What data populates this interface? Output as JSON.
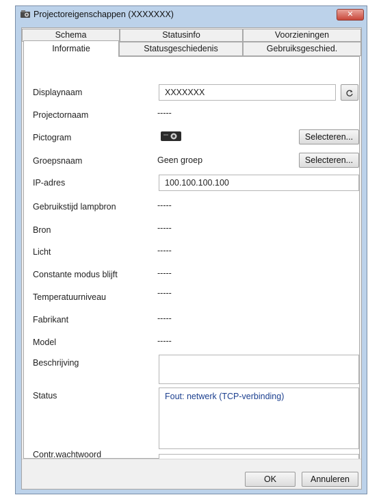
{
  "window": {
    "title": "Projectoreigenschappen (XXXXXXX)",
    "close_glyph": "✕"
  },
  "tabs": {
    "row1": [
      "Schema",
      "Statusinfo",
      "Voorzieningen"
    ],
    "row2": [
      "Informatie",
      "Statusgeschiedenis",
      "Gebruiksgeschied."
    ],
    "active": "Informatie"
  },
  "info": {
    "display_name_label": "Displaynaam",
    "display_name_value": "XXXXXXX",
    "projector_name_label": "Projectornaam",
    "projector_name_value": "-----",
    "icon_label": "Pictogram",
    "icon_select": "Selecteren...",
    "group_label": "Groepsnaam",
    "group_value": "Geen groep",
    "group_select": "Selecteren...",
    "ip_label": "IP-adres",
    "ip_value": "100.100.100.100",
    "lamp_label": "Gebruikstijd lampbron",
    "lamp_value": "-----",
    "source_label": "Bron",
    "source_value": "-----",
    "light_label": "Licht",
    "light_value": "-----",
    "constant_label": "Constante modus blijft",
    "constant_value": "-----",
    "temp_label": "Temperatuurniveau",
    "temp_value": "-----",
    "maker_label": "Fabrikant",
    "maker_value": "-----",
    "model_label": "Model",
    "model_value": "-----",
    "description_label": "Beschrijving",
    "description_value": "",
    "status_label": "Status",
    "status_value": "Fout: netwerk (TCP-verbinding)",
    "password_label": "Contr.wachtwoord",
    "password_value": ""
  },
  "footer": {
    "ok": "OK",
    "cancel": "Annuleren"
  },
  "icons": {
    "title": "projector-properties-icon",
    "refresh": "refresh-icon",
    "projector": "projector-icon"
  },
  "colors": {
    "title_bar": "#bcd2ea",
    "close": "#c8473a",
    "status_text": "#1b3f8f"
  }
}
